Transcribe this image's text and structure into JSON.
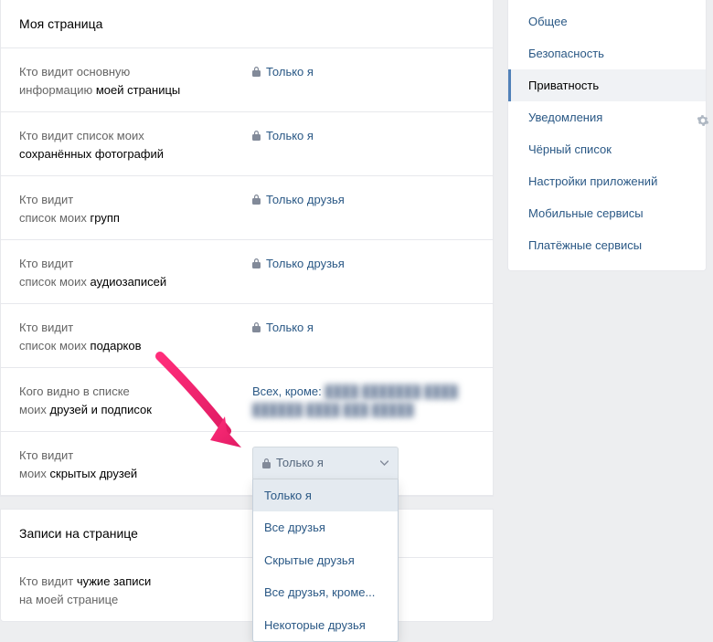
{
  "main": {
    "section1_title": "Моя страница",
    "section2_title": "Записи на странице",
    "rows": [
      {
        "l1": "Кто видит основную",
        "l2": "информацию ",
        "strong": "моей страницы",
        "value": "Только я",
        "locked": true
      },
      {
        "l1": "Кто видит список моих",
        "l2": "",
        "strong": "сохранённых фотографий",
        "value": "Только я",
        "locked": true
      },
      {
        "l1": "Кто видит",
        "l2": "список моих ",
        "strong": "групп",
        "value": "Только друзья",
        "locked": true
      },
      {
        "l1": "Кто видит",
        "l2": "список моих ",
        "strong": "аудиозаписей",
        "value": "Только друзья",
        "locked": true
      },
      {
        "l1": "Кто видит",
        "l2": "список моих ",
        "strong": "подарков",
        "value": "Только я",
        "locked": true
      },
      {
        "l1": "Кого видно в списке",
        "l2": "моих ",
        "strong": "друзей и подписок",
        "value_prefix": "Всех, кроме: ",
        "value_blur": "████  ███████  ████ ██████  ████  ███  █████"
      },
      {
        "l1": "Кто видит",
        "l2": "моих ",
        "strong": "скрытых друзей"
      }
    ],
    "row8": {
      "l1": "Кто видит ",
      "strong": "чужие записи",
      "l2": "на моей странице"
    },
    "dropdown": {
      "selected": "Только я",
      "options": [
        "Только я",
        "Все друзья",
        "Скрытые друзья",
        "Все друзья, кроме...",
        "Некоторые друзья"
      ]
    }
  },
  "sidebar": {
    "items": [
      {
        "label": "Общее"
      },
      {
        "label": "Безопасность"
      },
      {
        "label": "Приватность",
        "active": true
      },
      {
        "label": "Уведомления"
      },
      {
        "label": "Чёрный список"
      },
      {
        "label": "Настройки приложений"
      },
      {
        "label": "Мобильные сервисы"
      },
      {
        "label": "Платёжные сервисы"
      }
    ]
  }
}
